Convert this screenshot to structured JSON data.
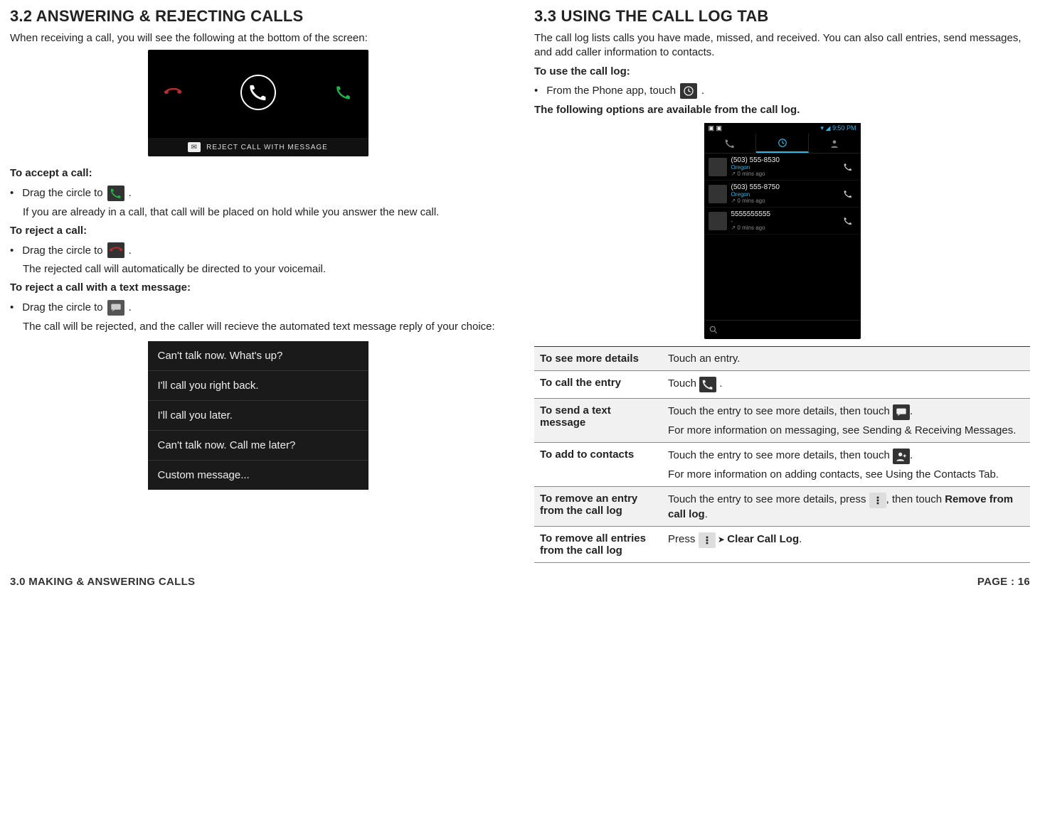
{
  "left": {
    "heading": "3.2 ANSWERING & REJECTING CALLS",
    "intro": "When receiving a call, you will see the following at the bottom of the screen:",
    "incoming_call": {
      "reject_bar_text": "REJECT CALL WITH MESSAGE"
    },
    "accept": {
      "title": "To accept a call:",
      "line": "Drag the circle to",
      "note": "If you are already in a call, that call will be placed on hold while you answer the new call."
    },
    "reject": {
      "title": "To reject a call:",
      "line": "Drag the circle to",
      "note": "The rejected call will automatically be directed to your voicemail."
    },
    "reject_msg": {
      "title": "To reject a call with a text message:",
      "line": "Drag the circle to",
      "note": "The call will be rejected, and the caller will recieve the automated text message reply of your choice:"
    },
    "quick_replies": [
      "Can't talk now. What's up?",
      "I'll call you right back.",
      "I'll call you later.",
      "Can't talk now. Call me later?",
      "Custom message..."
    ]
  },
  "right": {
    "heading": "3.3 USING THE CALL LOG TAB",
    "intro": "The call log lists calls you have made, missed, and received. You can also call entries, send messages, and add caller information to contacts.",
    "use_title": "To use the call log:",
    "use_line": "From the Phone app, touch",
    "available_title": "The following options are available from the call log.",
    "phone": {
      "status_time": "9:50 PM",
      "entries": [
        {
          "number": "(503) 555-8530",
          "sub": "Oregon",
          "time": "0 mins ago"
        },
        {
          "number": "(503) 555-8750",
          "sub": "Oregon",
          "time": "0 mins ago"
        },
        {
          "number": "5555555555",
          "sub": "-",
          "time": "0 mins ago"
        }
      ]
    },
    "options": [
      {
        "key": "To see more details",
        "val_pre": "Touch an entry."
      },
      {
        "key": "To call the entry",
        "val_pre": "Touch ",
        "icon": "phone",
        "val_post": " ."
      },
      {
        "key": "To send a text message",
        "val_pre": "Touch the entry to see more details, then touch ",
        "icon": "message",
        "val_post": ".",
        "extra": "For more information on messaging, see Sending & Receiving Messages."
      },
      {
        "key": "To add to contacts",
        "val_pre": "Touch the entry to see more details, then touch ",
        "icon": "contact-add",
        "val_post": ".",
        "extra": "For more information on adding contacts, see Using the Contacts Tab."
      },
      {
        "key": "To remove an entry from the call log",
        "val_pre": "Touch the entry to see more details, press ",
        "icon": "overflow",
        "val_post": ", then touch ",
        "bold_tail": "Remove from call log",
        "tail_post": "."
      },
      {
        "key": "To remove all entries from the call log",
        "val_pre": "Press ",
        "icon": "overflow",
        "arrow": true,
        "bold_tail": "Clear Call Log",
        "tail_post": "."
      }
    ]
  },
  "footer": {
    "left": "3.0 MAKING & ANSWERING CALLS",
    "right": "PAGE : 16"
  },
  "icon_names": {
    "phone_green": "phone-answer-icon",
    "phone_red": "phone-decline-icon",
    "message": "message-icon",
    "clock": "clock-icon",
    "contact": "contact-icon",
    "contact_add": "add-contact-icon",
    "overflow": "overflow-menu-icon",
    "search": "search-icon"
  }
}
